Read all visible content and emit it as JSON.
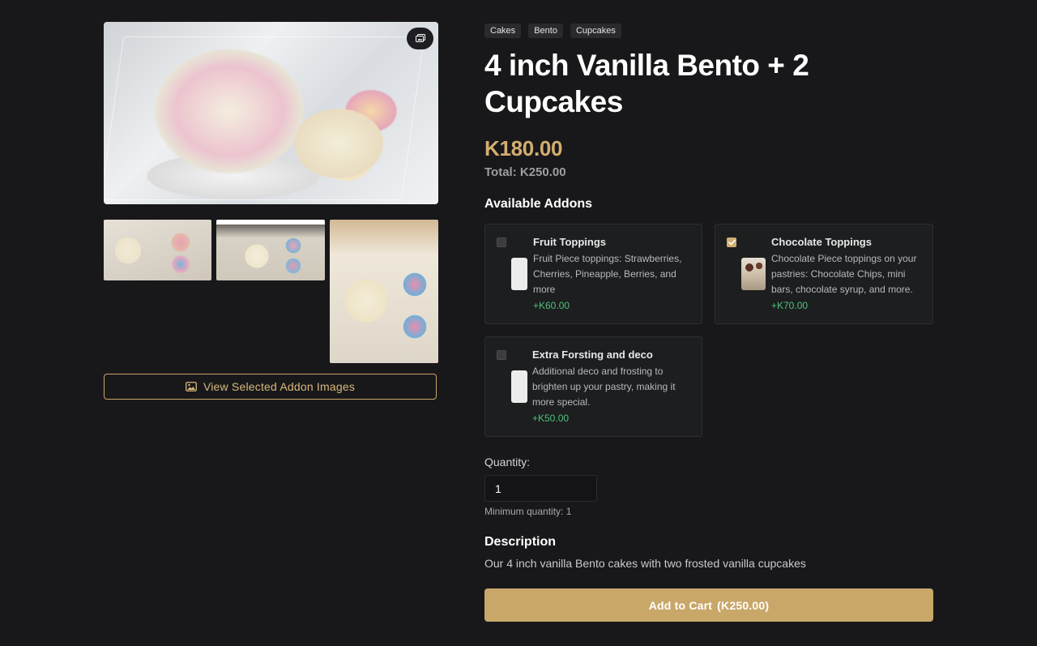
{
  "gallery": {
    "gallery_icon": "image-gallery-icon",
    "view_addon_images_icon": "image-icon",
    "view_addon_images_label": "View Selected Addon Images"
  },
  "product": {
    "tags": [
      "Cakes",
      "Bento",
      "Cupcakes"
    ],
    "title": "4 inch Vanilla Bento + 2 Cupcakes",
    "price": "K180.00",
    "total": "Total: K250.00"
  },
  "addons": {
    "heading": "Available Addons",
    "items": [
      {
        "name": "Fruit Toppings",
        "description": "Fruit Piece toppings: Strawberries, Cherries, Pineapple, Berries, and more",
        "price": "+K60.00",
        "checked": false
      },
      {
        "name": "Chocolate Toppings",
        "description": "Chocolate Piece toppings on your pastries: Chocolate Chips, mini bars, chocolate syrup, and more.",
        "price": "+K70.00",
        "checked": true
      },
      {
        "name": "Extra Forsting and deco",
        "description": "Additional deco and frosting to brighten up your pastry, making it more special.",
        "price": "+K50.00",
        "checked": false
      }
    ]
  },
  "quantity": {
    "label": "Quantity:",
    "value": "1",
    "minimum_text": "Minimum quantity: 1"
  },
  "description": {
    "heading": "Description",
    "text": "Our 4 inch vanilla Bento cakes with two frosted vanilla cupcakes"
  },
  "cart": {
    "label": "Add to Cart",
    "amount": "(K250.00)"
  },
  "colors": {
    "background": "#18181b",
    "accent_gold": "#c9a769",
    "price_gold": "#d4ae6f",
    "addon_price_green": "#4ec07a"
  }
}
